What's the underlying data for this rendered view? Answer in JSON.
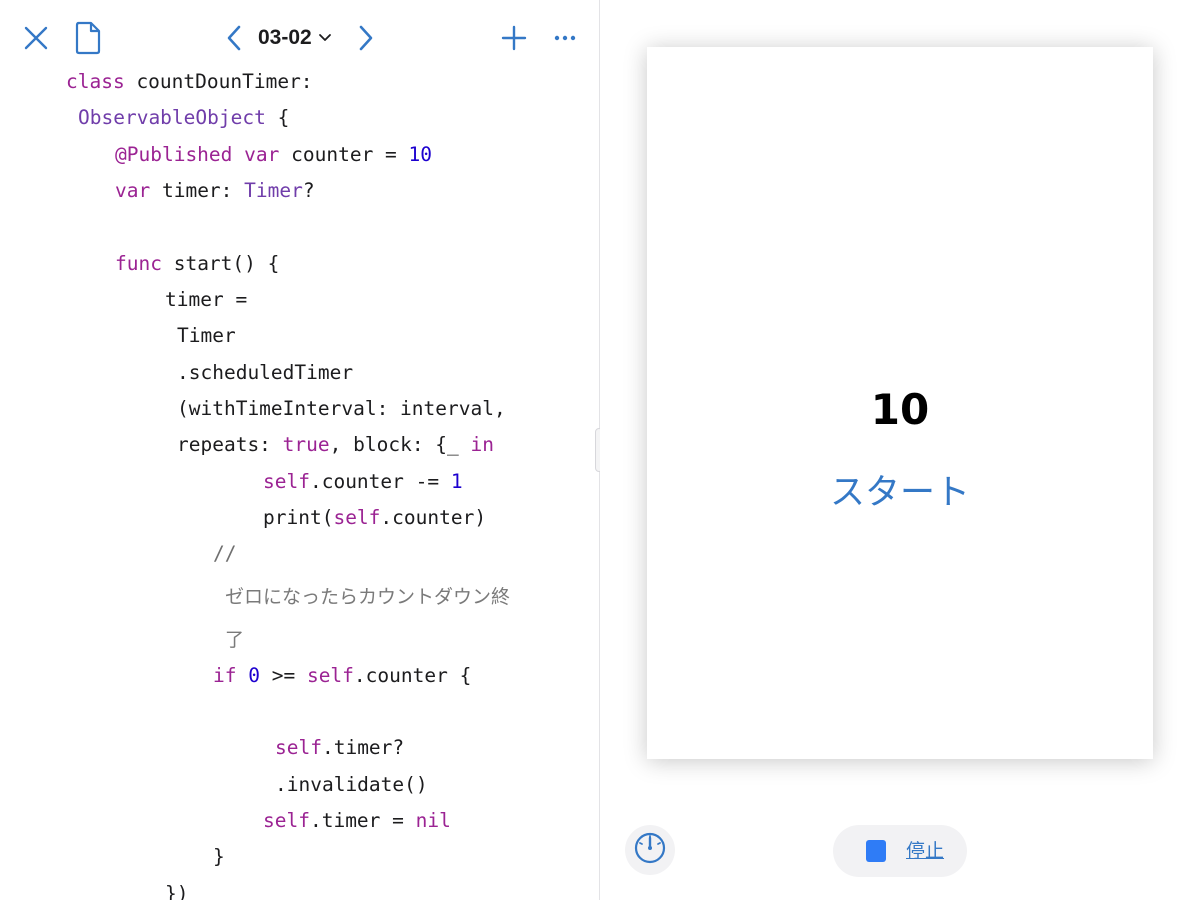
{
  "toolbar": {
    "file_name": "03-02"
  },
  "code": {
    "lines": [
      {
        "segments": [
          {
            "text": "class",
            "cls": "kw"
          },
          {
            "text": " countDounTimer:"
          }
        ]
      },
      {
        "segments": [
          {
            "text": "ObservableObject",
            "cls": "ty"
          },
          {
            "text": " {"
          }
        ]
      },
      {
        "segments": [
          {
            "text": "@Published",
            "cls": "kw"
          },
          {
            "text": " "
          },
          {
            "text": "var",
            "cls": "kw"
          },
          {
            "text": " counter = "
          },
          {
            "text": "10",
            "cls": "num"
          }
        ]
      },
      {
        "segments": [
          {
            "text": "var",
            "cls": "kw"
          },
          {
            "text": " timer: "
          },
          {
            "text": "Timer",
            "cls": "ty"
          },
          {
            "text": "?"
          }
        ]
      },
      {
        "segments": []
      },
      {
        "segments": [
          {
            "text": "func",
            "cls": "kw"
          },
          {
            "text": " start() {"
          }
        ]
      },
      {
        "segments": [
          {
            "text": "timer ="
          }
        ]
      },
      {
        "segments": [
          {
            "text": "Timer"
          }
        ]
      },
      {
        "segments": [
          {
            "text": ".scheduledTimer"
          }
        ]
      },
      {
        "segments": [
          {
            "text": "(withTimeInterval: interval,"
          }
        ]
      },
      {
        "segments": [
          {
            "text": "repeats: "
          },
          {
            "text": "true",
            "cls": "kw"
          },
          {
            "text": ", block: {_ "
          },
          {
            "text": "in",
            "cls": "kw"
          }
        ]
      },
      {
        "segments": [
          {
            "text": "self",
            "cls": "kw"
          },
          {
            "text": ".counter -= "
          },
          {
            "text": "1",
            "cls": "num"
          }
        ]
      },
      {
        "segments": [
          {
            "text": "print("
          },
          {
            "text": "self",
            "cls": "kw"
          },
          {
            "text": ".counter)"
          }
        ]
      },
      {
        "segments": [
          {
            "text": "//",
            "cls": "cm"
          }
        ]
      },
      {
        "segments": [
          {
            "text": "ゼロになったらカウントダウン終",
            "cls": "cmj"
          }
        ]
      },
      {
        "segments": [
          {
            "text": "了",
            "cls": "cmj"
          }
        ]
      },
      {
        "segments": [
          {
            "text": "if",
            "cls": "kw"
          },
          {
            "text": " "
          },
          {
            "text": "0",
            "cls": "num"
          },
          {
            "text": " >= "
          },
          {
            "text": "self",
            "cls": "kw"
          },
          {
            "text": ".counter {"
          }
        ]
      },
      {
        "segments": []
      },
      {
        "segments": [
          {
            "text": "self",
            "cls": "kw"
          },
          {
            "text": ".timer?"
          }
        ]
      },
      {
        "segments": [
          {
            "text": ".invalidate()"
          }
        ]
      },
      {
        "segments": [
          {
            "text": "self",
            "cls": "kw"
          },
          {
            "text": ".timer = "
          },
          {
            "text": "nil",
            "cls": "kw"
          }
        ]
      },
      {
        "segments": [
          {
            "text": "}"
          }
        ]
      },
      {
        "segments": [
          {
            "text": "})"
          }
        ]
      }
    ]
  },
  "preview": {
    "counter": "10",
    "start_label": "スタート"
  },
  "run_controls": {
    "stop_label": "停止"
  },
  "icons": {
    "close": "close-icon",
    "document": "document-icon",
    "prev": "chevron-left-icon",
    "title_menu": "chevron-down-icon",
    "next": "chevron-right-icon",
    "add": "plus-icon",
    "more": "ellipsis-icon",
    "gauge": "speedometer-icon",
    "stop": "stop-icon"
  },
  "colors": {
    "accent": "#3478c6",
    "keyword": "#9b2393",
    "type": "#703daa",
    "number": "#1c00cf",
    "comment": "#707070",
    "stop_square": "#2f7cf6"
  }
}
